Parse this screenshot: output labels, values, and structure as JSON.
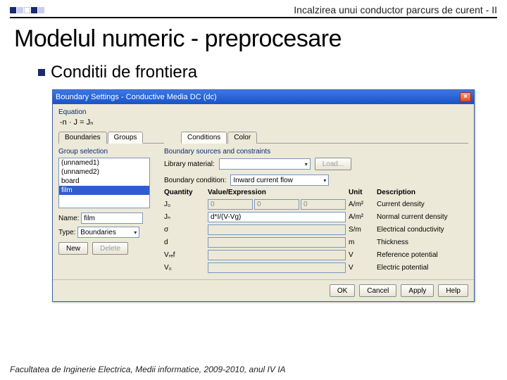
{
  "header": {
    "title_text": "Incalzirea unui conductor parcurs de curent - II"
  },
  "slide": {
    "title": "Modelul numeric - preprocesare",
    "subtitle": "Conditii de frontiera"
  },
  "footer": "Facultatea de Inginerie Electrica, Medii informatice, 2009-2010, anul IV IA",
  "dialog": {
    "title": "Boundary Settings - Conductive Media DC (dc)",
    "equation_label": "Equation",
    "equation": "-n · J = Jₙ",
    "tabs_left": [
      "Boundaries",
      "Groups"
    ],
    "tabs_right": [
      "Conditions",
      "Color"
    ],
    "group_selection_label": "Group selection",
    "group_items": [
      "(unnamed1)",
      "(unnamed2)",
      "board",
      "film"
    ],
    "name_label": "Name:",
    "name_value": "film",
    "type_label": "Type:",
    "type_value": "Boundaries",
    "new_btn": "New",
    "delete_btn": "Delete",
    "sources_label": "Boundary sources and constraints",
    "library_label": "Library material:",
    "library_value": "",
    "load_btn": "Load...",
    "bc_label": "Boundary condition:",
    "bc_value": "Inward current flow",
    "headers": {
      "q": "Quantity",
      "v": "Value/Expression",
      "u": "Unit",
      "d": "Description"
    },
    "rows": [
      {
        "q": "J₀",
        "v3": [
          "0",
          "0",
          "0"
        ],
        "u": "A/m²",
        "d": "Current density",
        "active": false
      },
      {
        "q": "Jₙ",
        "v": "d*I/(V-Vg)",
        "u": "A/m²",
        "d": "Normal current density",
        "active": true
      },
      {
        "q": "σ",
        "v": "",
        "u": "S/m",
        "d": "Electrical conductivity",
        "active": false
      },
      {
        "q": "d",
        "v": "",
        "u": "m",
        "d": "Thickness",
        "active": false
      },
      {
        "q": "Vᵣₑf",
        "v": "",
        "u": "V",
        "d": "Reference potential",
        "active": false
      },
      {
        "q": "V₀",
        "v": "",
        "u": "V",
        "d": "Electric potential",
        "active": false
      }
    ],
    "buttons": {
      "ok": "OK",
      "cancel": "Cancel",
      "apply": "Apply",
      "help": "Help"
    }
  }
}
